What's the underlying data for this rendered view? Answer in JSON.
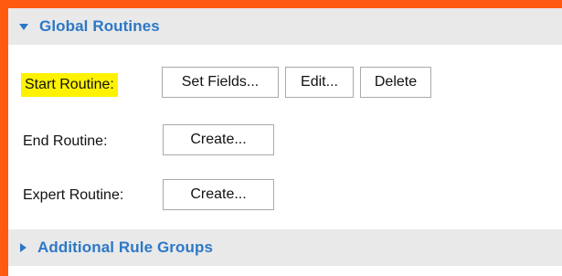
{
  "sections": {
    "global": {
      "title": "Global Routines",
      "expanded": true
    },
    "additional": {
      "title": "Additional Rule Groups",
      "expanded": false
    }
  },
  "routines": {
    "start": {
      "label": "Start Routine:",
      "highlight_color": "#fff200",
      "buttons": {
        "set_fields": "Set Fields...",
        "edit": "Edit...",
        "delete": "Delete"
      }
    },
    "end": {
      "label": "End Routine:",
      "buttons": {
        "create": "Create..."
      }
    },
    "expert": {
      "label": "Expert Routine:",
      "buttons": {
        "create": "Create..."
      }
    }
  },
  "colors": {
    "frame": "#ff5a0f",
    "header_bg": "#e9e9ea",
    "header_text": "#2c78c6"
  }
}
